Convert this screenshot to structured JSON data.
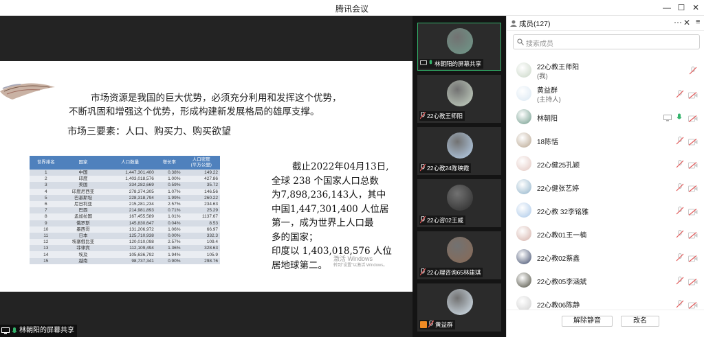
{
  "window": {
    "title": "腾讯会议"
  },
  "slide": {
    "para1_line1": "市场资源是我国的巨大优势，必须充分利用和发挥这个优势，",
    "para1_line2": "不断巩固和增强这个优势，形成构建新发展格局的雄厚支撑。",
    "para2": "市场三要素：人口、购买力、购买欲望",
    "para3_lines": [
      "截止2022年04月13日,",
      "全球 238 个国家人口总数",
      "为7,898,236,143人，其中",
      "中国1,447,301,400 人位居",
      "第一，成为世界上人口最",
      "多的国家；",
      "印度以 1,403,018,576 人位",
      "居地球第二。"
    ],
    "watermark_line1": "激活 Windows",
    "watermark_line2": "转到\"设置\"以激活 Windows。",
    "table": {
      "headers": [
        "世界排名",
        "国家",
        "人口数量",
        "增长率",
        "人口密度\n(平方公里)"
      ],
      "rows": [
        [
          "1",
          "中国",
          "1,447,301,400",
          "0.38%",
          "149.22"
        ],
        [
          "2",
          "印度",
          "1,403,018,576",
          "1.00%",
          "427.86"
        ],
        [
          "3",
          "美国",
          "334,282,669",
          "0.59%",
          "35.72"
        ],
        [
          "4",
          "印度尼西亚",
          "278,374,305",
          "1.07%",
          "146.56"
        ],
        [
          "5",
          "巴基斯坦",
          "228,318,794",
          "1.99%",
          "260.22"
        ],
        [
          "6",
          "尼日利亚",
          "215,281,234",
          "2.57%",
          "234.63"
        ],
        [
          "7",
          "巴西",
          "214,981,893",
          "0.71%",
          "25.29"
        ],
        [
          "8",
          "孟加拉国",
          "167,455,589",
          "1.01%",
          "1137.67"
        ],
        [
          "9",
          "俄罗斯",
          "145,830,647",
          "0.04%",
          "8.53"
        ],
        [
          "10",
          "墨西哥",
          "131,206,972",
          "1.06%",
          "66.97"
        ],
        [
          "11",
          "日本",
          "125,710,938",
          "0.00%",
          "332.3"
        ],
        [
          "12",
          "埃塞俄比亚",
          "120,010,098",
          "2.57%",
          "109.4"
        ],
        [
          "13",
          "菲律宾",
          "112,109,494",
          "1.36%",
          "328.63"
        ],
        [
          "14",
          "埃及",
          "105,636,792",
          "1.94%",
          "105.9"
        ],
        [
          "15",
          "越南",
          "98,737,341",
          "0.90%",
          "298.76"
        ]
      ]
    }
  },
  "share_label": "林朝阳的屏幕共享",
  "video_tiles": [
    {
      "name": "林朝阳的屏幕共享",
      "color": "#6f9a8a",
      "active": true,
      "kind": "share"
    },
    {
      "name": "22心教王师阳",
      "color": "#c9d6c6",
      "active": false,
      "kind": "mute"
    },
    {
      "name": "22心教24陈映霞",
      "color": "#b9d3ee",
      "active": false,
      "kind": "mute"
    },
    {
      "name": "22心咨02王威",
      "color": "#2a2a2a",
      "active": false,
      "kind": "mute"
    },
    {
      "name": "22心理咨询65林建琪",
      "color": "#8a6a55",
      "active": false,
      "kind": "mute"
    },
    {
      "name": "黄益群",
      "color": "#d9e7f2",
      "active": false,
      "kind": "host"
    }
  ],
  "members": {
    "title": "成员(127)",
    "search_placeholder": "搜索成员",
    "list": [
      {
        "name": "22心教王师阳",
        "sub": "(我)",
        "color": "#c9d6c6",
        "state": "mic-only"
      },
      {
        "name": "黄益群",
        "sub": "(主持人)",
        "color": "#d9e7f2",
        "state": "muted"
      },
      {
        "name": "林朝阳",
        "sub": "",
        "color": "#6f9a8a",
        "state": "sharing"
      },
      {
        "name": "18陈恬",
        "sub": "",
        "color": "#b7a48e",
        "state": "muted"
      },
      {
        "name": "22心健25孔颖",
        "sub": "",
        "color": "#e2c6c0",
        "state": "muted"
      },
      {
        "name": "22心健张艺婷",
        "sub": "",
        "color": "#8fb2c9",
        "state": "muted"
      },
      {
        "name": "22心教 32李铭雅",
        "sub": "",
        "color": "#a9c7e8",
        "state": "muted"
      },
      {
        "name": "22心教01王一楠",
        "sub": "",
        "color": "#d4b0a8",
        "state": "muted"
      },
      {
        "name": "22心教02蔡鑫",
        "sub": "",
        "color": "#3d4a6a",
        "state": "muted"
      },
      {
        "name": "22心教05李涵斌",
        "sub": "",
        "color": "#4a4a3c",
        "state": "muted"
      },
      {
        "name": "22心教06陈静",
        "sub": "",
        "color": "#cfcfcf",
        "state": "muted"
      }
    ],
    "unmute_label": "解除静音",
    "rename_label": "改名"
  },
  "colors": {
    "accent_green": "#33b36b",
    "muted_red": "#e35a5a",
    "table_header": "#4f81bd"
  },
  "icons": [
    "minimize-icon",
    "maximize-icon",
    "close-icon",
    "more-icon",
    "search-icon",
    "mic-off-icon",
    "camera-off-icon",
    "screen-share-icon",
    "mic-on-icon"
  ]
}
